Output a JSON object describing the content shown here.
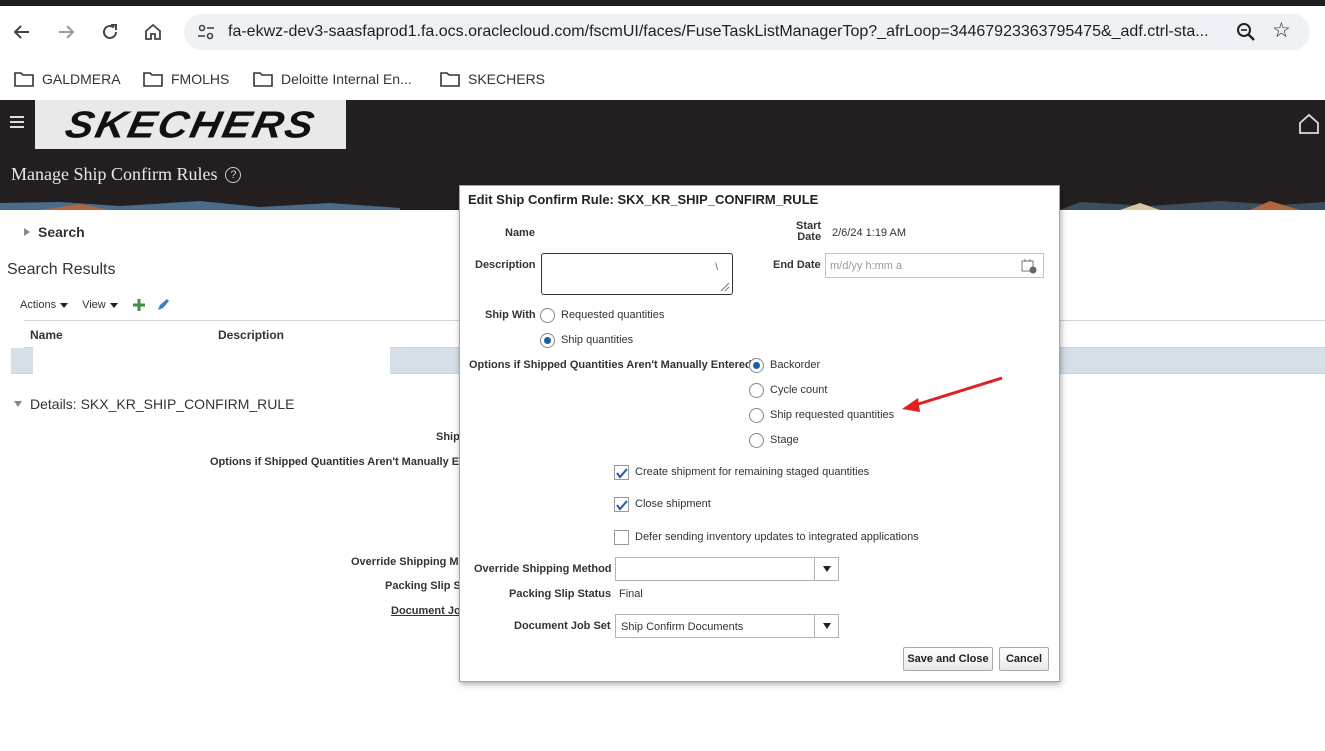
{
  "browser": {
    "url": "fa-ekwz-dev3-saasfaprod1.fa.ocs.oraclecloud.com/fscmUI/faces/FuseTaskListManagerTop?_afrLoop=34467923363795475&_adf.ctrl-sta...",
    "bookmarks": [
      "GALDMERA",
      "FMOLHS",
      "Deloitte Internal En...",
      "SKECHERS"
    ]
  },
  "app": {
    "logo_text": "SKECHERS",
    "page_title": "Manage Ship Confirm Rules",
    "help_glyph": "?"
  },
  "page": {
    "search_label": "Search",
    "search_results_label": "Search Results",
    "actions_label": "Actions",
    "view_label": "View",
    "columns": [
      "Name",
      "Description"
    ],
    "details_title": "Details: SKX_KR_SHIP_CONFIRM_RULE",
    "details_labels": {
      "ship": "Ship",
      "options": "Options if Shipped Quantities Aren't Manually En",
      "override": "Override Shipping Me",
      "packing": "Packing Slip S",
      "docjob": "Document Jo"
    }
  },
  "dialog": {
    "title": "Edit Ship Confirm Rule: SKX_KR_SHIP_CONFIRM_RULE",
    "name_label": "Name",
    "start_date_label_1": "Start",
    "start_date_label_2": "Date",
    "start_date_value": "2/6/24 1:19 AM",
    "description_label": "Description",
    "end_date_label": "End Date",
    "end_date_placeholder": "m/d/yy h:mm a",
    "ship_with_label": "Ship With",
    "ship_with_options": [
      {
        "label": "Requested quantities",
        "selected": false
      },
      {
        "label": "Ship quantities",
        "selected": true
      }
    ],
    "options_label": "Options if Shipped Quantities Aren't Manually Entered",
    "options": [
      {
        "label": "Backorder",
        "selected": true
      },
      {
        "label": "Cycle count",
        "selected": false
      },
      {
        "label": "Ship requested quantities",
        "selected": false
      },
      {
        "label": "Stage",
        "selected": false
      }
    ],
    "checkboxes": [
      {
        "label": "Create shipment for remaining staged quantities",
        "checked": true
      },
      {
        "label": "Close shipment",
        "checked": true
      },
      {
        "label": "Defer sending inventory updates to integrated applications",
        "checked": false
      }
    ],
    "override_label": "Override Shipping Method",
    "override_value": "",
    "packing_label": "Packing Slip Status",
    "packing_value": "Final",
    "docjob_label": "Document Job Set",
    "docjob_value": "Ship Confirm Documents",
    "save_close_label": "Save and Close",
    "cancel_label": "Cancel"
  },
  "colors": {
    "header_bg": "#231f20",
    "radio_selected": "#1a5ea8",
    "annotation_arrow": "#e02020",
    "selected_row": "#d6dfe8"
  }
}
